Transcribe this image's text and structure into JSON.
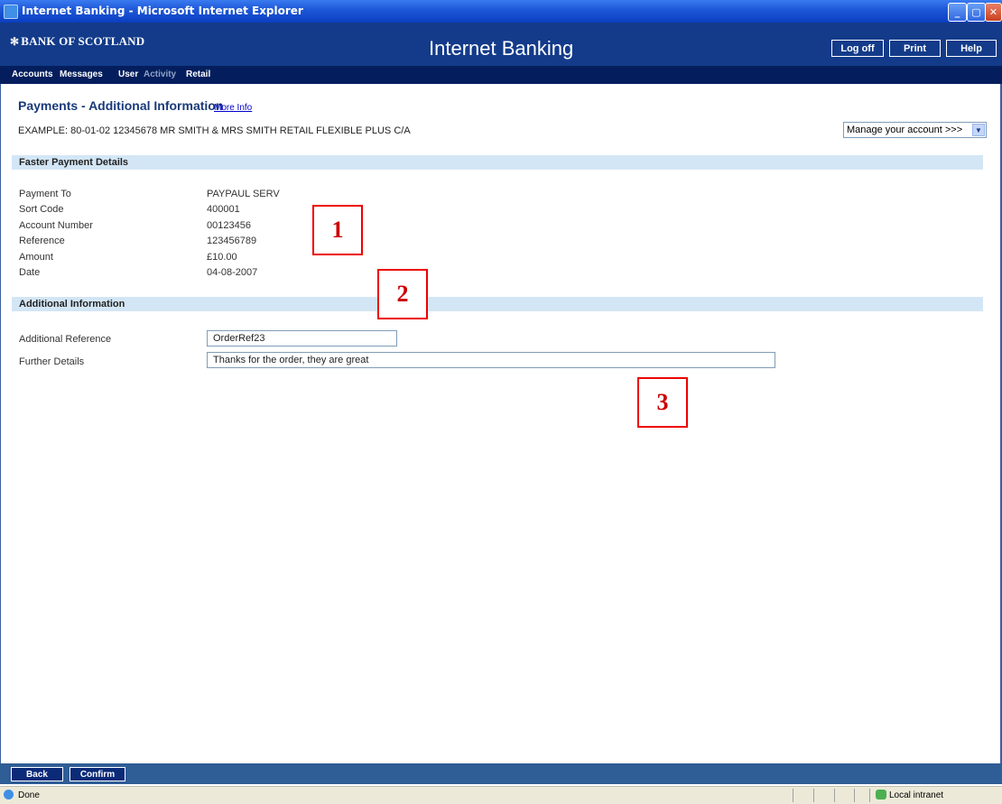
{
  "window": {
    "title": "Internet Banking - Microsoft Internet Explorer",
    "controls": {
      "minimize": "_",
      "maximize": "▢",
      "close": "✕"
    }
  },
  "header": {
    "logo": "BANK OF SCOTLAND",
    "logo_mark": "✻",
    "brand": "Internet Banking",
    "buttons": {
      "log_off": "Log off",
      "print": "Print",
      "help": "Help"
    }
  },
  "menu": {
    "accounts": "Accounts",
    "messages": "Messages",
    "user": "User",
    "activity": "Activity",
    "retail": "Retail"
  },
  "page": {
    "title": "Payments - Additional Information",
    "more_info": "More Info",
    "account_line": "EXAMPLE: 80-01-02 12345678 MR SMITH & MRS SMITH RETAIL FLEXIBLE PLUS C/A",
    "manage_select": "Manage your account >>>",
    "manage_arrow": "▼"
  },
  "payment": {
    "section_title": "Faster Payment Details",
    "rows": [
      {
        "label": "Payment To",
        "value": "PAYPAUL SERV"
      },
      {
        "label": "Sort Code",
        "value": "400001"
      },
      {
        "label": "Account Number",
        "value": "00123456"
      },
      {
        "label": "Reference",
        "value": "123456789"
      },
      {
        "label": "Amount",
        "value": "£10.00"
      },
      {
        "label": "Date",
        "value": "04-08-2007"
      }
    ]
  },
  "additional": {
    "section_title": "Additional Information",
    "additional_reference_label": "Additional Reference",
    "additional_reference_value": "OrderRef23",
    "further_details_label": "Further Details",
    "further_details_value": "Thanks for the order, they are great"
  },
  "annotations": [
    "1",
    "2",
    "3"
  ],
  "footer": {
    "back": "Back",
    "confirm": "Confirm"
  },
  "status": {
    "done": "Done",
    "zone": "Local intranet"
  },
  "colors": {
    "header": "#133b8a",
    "menu": "#041e5d",
    "section": "#d3e6f5",
    "annotation": "#e00000"
  }
}
